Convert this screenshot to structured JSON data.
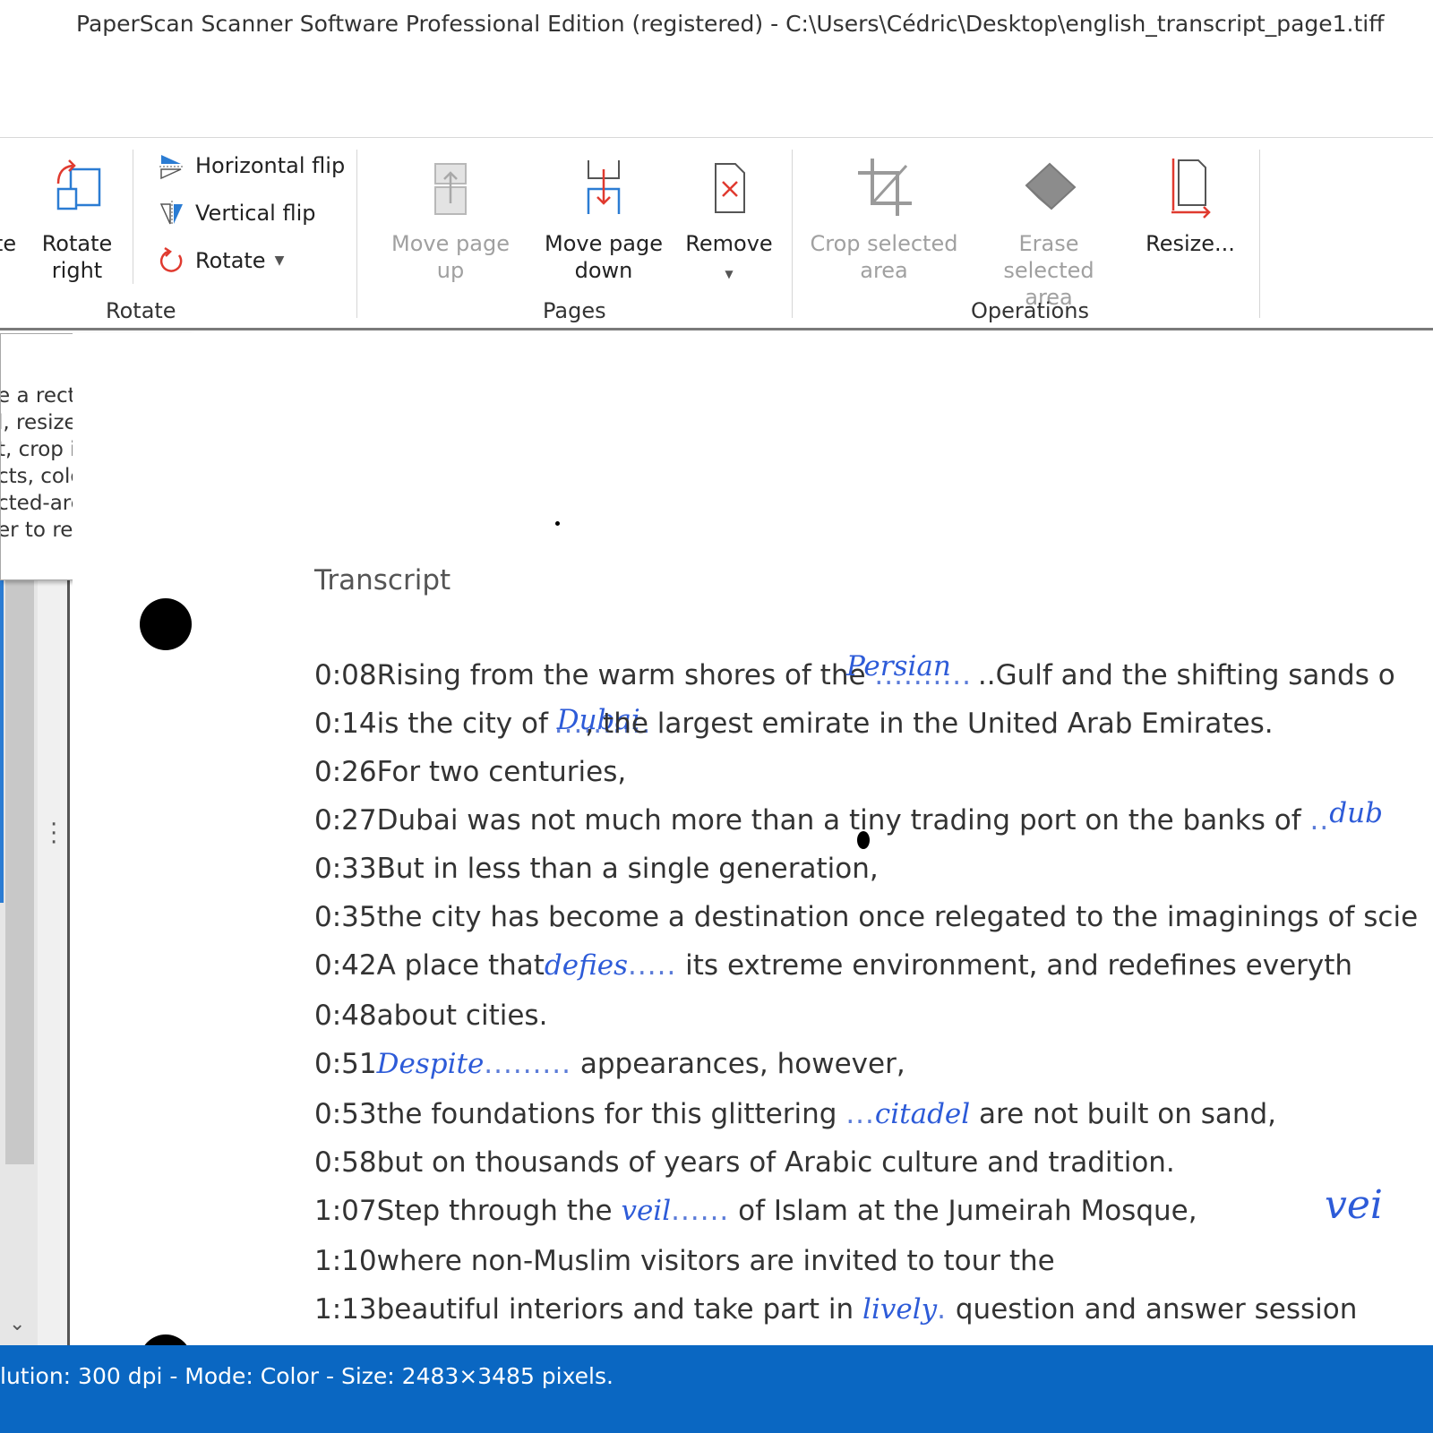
{
  "window": {
    "title": "PaperScan Scanner Software Professional Edition (registered) - C:\\Users\\Cédric\\Desktop\\english_transcript_page1.tiff"
  },
  "ribbon": {
    "rotate_group": {
      "label": "Rotate",
      "partial_left_label": "te",
      "rotate_right_line1": "Rotate",
      "rotate_right_line2": "right",
      "horizontal_flip": "Horizontal flip",
      "vertical_flip": "Vertical flip",
      "rotate": "Rotate"
    },
    "pages_group": {
      "label": "Pages",
      "move_page_up": "Move page up",
      "move_page_down_line1": "Move page",
      "move_page_down_line2": "down",
      "remove": "Remove"
    },
    "operations_group": {
      "label": "Operations",
      "crop_line1": "Crop selected",
      "crop_line2": "area",
      "erase_line1": "Erase",
      "erase_line2": "selected area",
      "resize": "Resize..."
    }
  },
  "tooltip": {
    "lines": [
      "e a rectangular",
      "l, resized or",
      "t, crop it from the",
      "cts, color",
      "cted-area to a",
      "er to remove the"
    ]
  },
  "document": {
    "heading": "Transcript",
    "lines": [
      {
        "time": "0:08",
        "before": "Rising from the warm shores of the ",
        "hand": "Persian",
        "dots": "..........",
        "after": "..Gulf and the shifting sands o"
      },
      {
        "time": "0:14",
        "before": "is the city of ",
        "hand": "Dubai",
        "dots": "..........",
        "after": ", the largest emirate in the United Arab Emirates."
      },
      {
        "time": "0:26",
        "before": "For two centuries,",
        "hand": "",
        "dots": "",
        "after": ""
      },
      {
        "time": "0:27",
        "before": "Dubai was not much more than a tiny trading port on the banks of ",
        "hand": "dub",
        "dots": "..",
        "after": ""
      },
      {
        "time": "0:33",
        "before": "But in less than a single generation,",
        "hand": "",
        "dots": "",
        "after": ""
      },
      {
        "time": "0:35",
        "before": "the city has become a destination once relegated to the imaginings of scie",
        "hand": "",
        "dots": "",
        "after": ""
      },
      {
        "time": "0:42",
        "before": "A place that",
        "hand": "defies",
        "dots": ".....",
        "after": " its extreme environment, and redefines everyth"
      },
      {
        "time": "0:48",
        "before": "about cities.",
        "hand": "",
        "dots": "",
        "after": ""
      },
      {
        "time": "0:51",
        "before": "",
        "hand": "Despite",
        "dots": ".........",
        "after": " appearances, however,"
      },
      {
        "time": "0:53",
        "before": "the foundations for this glittering ",
        "hand": "citadel",
        "dots": "...",
        "after": " are not built on sand,"
      },
      {
        "time": "0:58",
        "before": "but on thousands of years of Arabic culture and tradition.",
        "hand": "",
        "dots": "",
        "after": ""
      },
      {
        "time": "1:07",
        "before": "Step through the ",
        "hand": "veil",
        "dots": "......",
        "after": " of Islam at the Jumeirah Mosque,"
      },
      {
        "time": "1:10",
        "before": "where non-Muslim visitors are invited to tour the",
        "hand": "",
        "dots": "",
        "after": ""
      },
      {
        "time": "1:13",
        "before": "beautiful interiors and take part in ",
        "hand": "lively",
        "dots": ".",
        "after": " question and answer session"
      }
    ],
    "margin_note": "vei"
  },
  "status": {
    "text": "lution:  300 dpi - Mode: Color - Size: 2483×3485 pixels."
  },
  "colors": {
    "status_bar": "#0a67c2",
    "handwriting": "#2d5bd8",
    "icon_blue": "#2b7cd3",
    "icon_red": "#e03a2f"
  }
}
